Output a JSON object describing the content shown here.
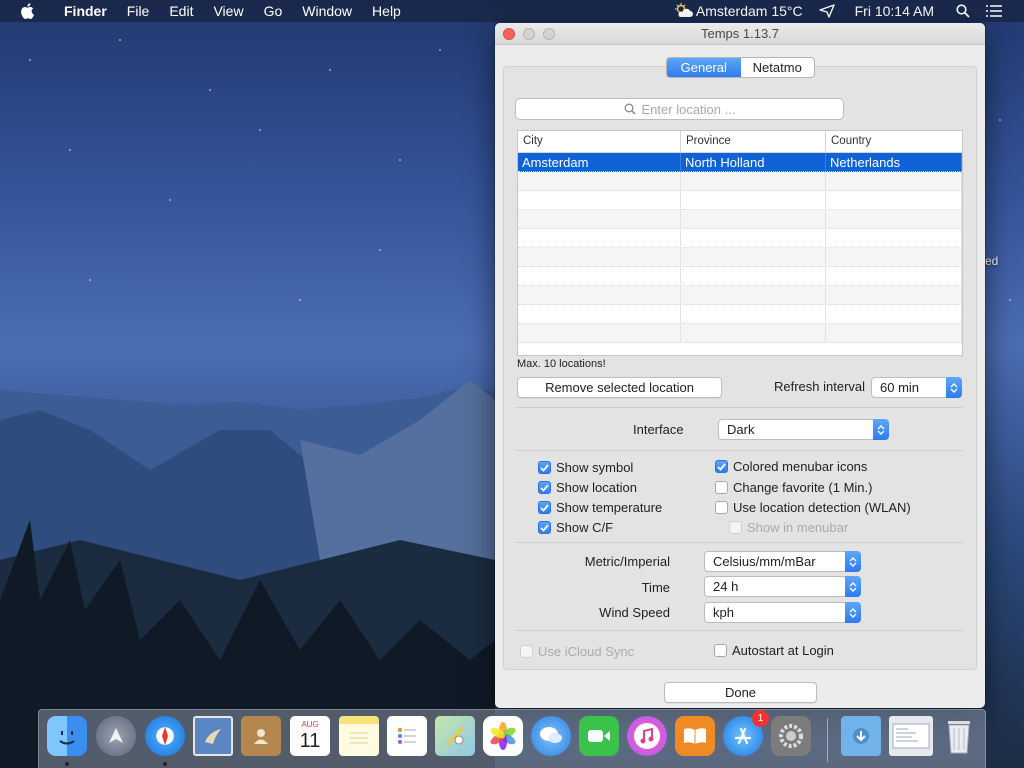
{
  "menubar": {
    "app_name": "Finder",
    "menus": [
      "File",
      "Edit",
      "View",
      "Go",
      "Window",
      "Help"
    ],
    "weather_status": "Amsterdam 15°C",
    "clock": "Fri 10:14 AM",
    "icons": [
      "apple-icon",
      "weather-sun-cloud-icon",
      "location-arrow-icon",
      "search-icon",
      "list-icon"
    ]
  },
  "desktop": {
    "fragment_text": "ed"
  },
  "window": {
    "title": "Temps 1.13.7",
    "tabs": [
      {
        "label": "General",
        "active": true
      },
      {
        "label": "Netatmo",
        "active": false
      }
    ],
    "search": {
      "placeholder": "Enter location ..."
    },
    "table": {
      "columns": [
        "City",
        "Province",
        "Country"
      ],
      "rows": [
        {
          "city": "Amsterdam",
          "province": "North Holland",
          "country": "Netherlands",
          "selected": true
        }
      ]
    },
    "max_note": "Max. 10 locations!",
    "remove_button": "Remove selected location",
    "refresh_label": "Refresh interval",
    "refresh_value": "60 min",
    "interface_label": "Interface",
    "interface_value": "Dark",
    "checkboxes_left": [
      {
        "label": "Show symbol",
        "checked": true
      },
      {
        "label": "Show location",
        "checked": true
      },
      {
        "label": "Show temperature",
        "checked": true
      },
      {
        "label": "Show C/F",
        "checked": true
      }
    ],
    "checkboxes_right": [
      {
        "label": "Colored menubar icons",
        "checked": true,
        "disabled": false
      },
      {
        "label": "Change favorite (1 Min.)",
        "checked": false,
        "disabled": false
      },
      {
        "label": "Use location detection (WLAN)",
        "checked": false,
        "disabled": false
      },
      {
        "label": "Show in menubar",
        "checked": false,
        "disabled": true
      }
    ],
    "units": [
      {
        "label": "Metric/Imperial",
        "value": "Celsius/mm/mBar"
      },
      {
        "label": "Time",
        "value": "24 h"
      },
      {
        "label": "Wind Speed",
        "value": "kph"
      }
    ],
    "icloud_sync": {
      "label": "Use iCloud Sync",
      "checked": false,
      "disabled": true
    },
    "autostart": {
      "label": "Autostart at Login",
      "checked": false
    },
    "done_button": "Done"
  },
  "dock": {
    "apps": [
      "finder-icon",
      "launchpad-icon",
      "safari-icon",
      "mail-icon",
      "contacts-icon",
      "calendar-icon",
      "notes-icon",
      "reminders-icon",
      "maps-icon",
      "photos-icon",
      "messages-icon",
      "facetime-icon",
      "itunes-icon",
      "ibooks-icon",
      "app-store-icon",
      "system-preferences-icon",
      "downloads-folder-icon",
      "documents-stack-icon",
      "trash-icon"
    ],
    "calendar_month": "AUG",
    "calendar_day": "11",
    "app_store_badge": "1"
  },
  "colors": {
    "accent": "#2b7cf0",
    "selection": "#0f63d6"
  }
}
